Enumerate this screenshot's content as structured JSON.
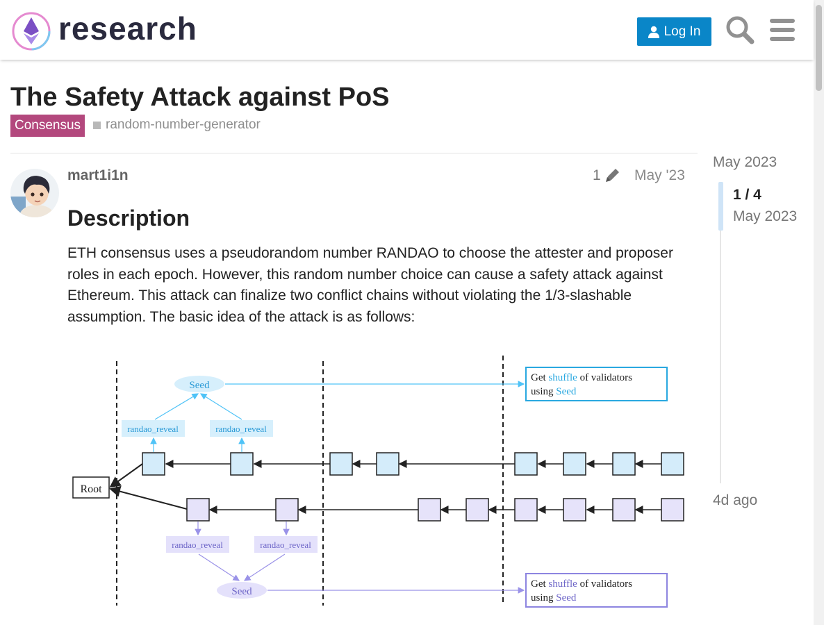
{
  "header": {
    "brand": "research",
    "login_label": "Log In",
    "icons": [
      "logo-icon",
      "user-icon",
      "search-icon",
      "hamburger-menu-icon"
    ],
    "accent_color": "#0a86c8"
  },
  "topic": {
    "title": "The Safety Attack against PoS",
    "category": "Consensus",
    "category_color": "#b3487d",
    "tag": "random-number-generator"
  },
  "post": {
    "username": "mart1i1n",
    "edit_count": "1",
    "date": "May '23",
    "heading": "Description",
    "body": "ETH consensus uses a pseudorandom number RANDAO to choose the attester and proposer roles in each epoch. However, this random number choice can cause a safety attack against Ethereum. This attack can finalize two conflict chains without violating the 1/3-slashable assumption. The basic idea of the attack is as follows:"
  },
  "diagram": {
    "root_label": "Root",
    "seed_label": "Seed",
    "reveal_label": "randao_reveal",
    "box_line1_a": "Get ",
    "box_line1_b": "shuffle",
    "box_line1_c": " of validators",
    "box_line2_a": "using ",
    "box_line2_b": "Seed",
    "upper_color": "#4fc3f7",
    "lower_color": "#9a92e8"
  },
  "timeline": {
    "start": "May 2023",
    "position": "1 / 4",
    "position_date": "May 2023",
    "end": "4d ago"
  }
}
